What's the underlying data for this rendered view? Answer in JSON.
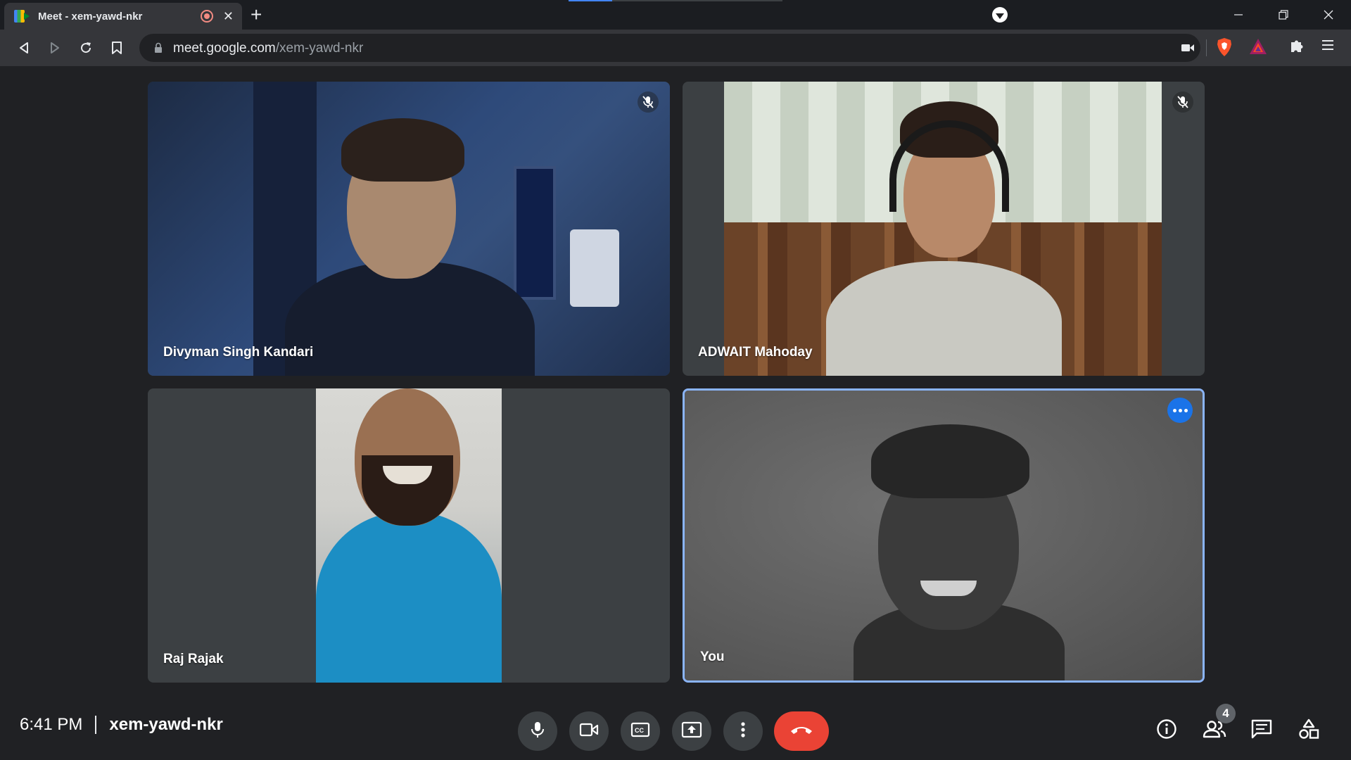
{
  "browser": {
    "tab_title": "Meet - xem-yawd-nkr",
    "url_host": "meet.google.com",
    "url_path": "/xem-yawd-nkr"
  },
  "participants": [
    {
      "name": "Divyman Singh Kandari",
      "muted": true
    },
    {
      "name": "ADWAIT Mahoday",
      "muted": true
    },
    {
      "name": "Raj Rajak",
      "muted": false
    },
    {
      "name": "You",
      "muted": false,
      "self": true
    }
  ],
  "footer": {
    "time": "6:41 PM",
    "meeting_code": "xem-yawd-nkr",
    "participant_count": "4"
  },
  "colors": {
    "background": "#202124",
    "tile": "#3c4043",
    "hangup": "#ea4335",
    "self_outline": "#8ab4f8",
    "accent": "#1a73e8"
  },
  "icons": {
    "controls": [
      "mic-icon",
      "camera-icon",
      "captions-icon",
      "present-icon",
      "more-options-icon",
      "hang-up-icon"
    ],
    "right": [
      "info-icon",
      "people-icon",
      "chat-icon",
      "activities-icon"
    ]
  }
}
